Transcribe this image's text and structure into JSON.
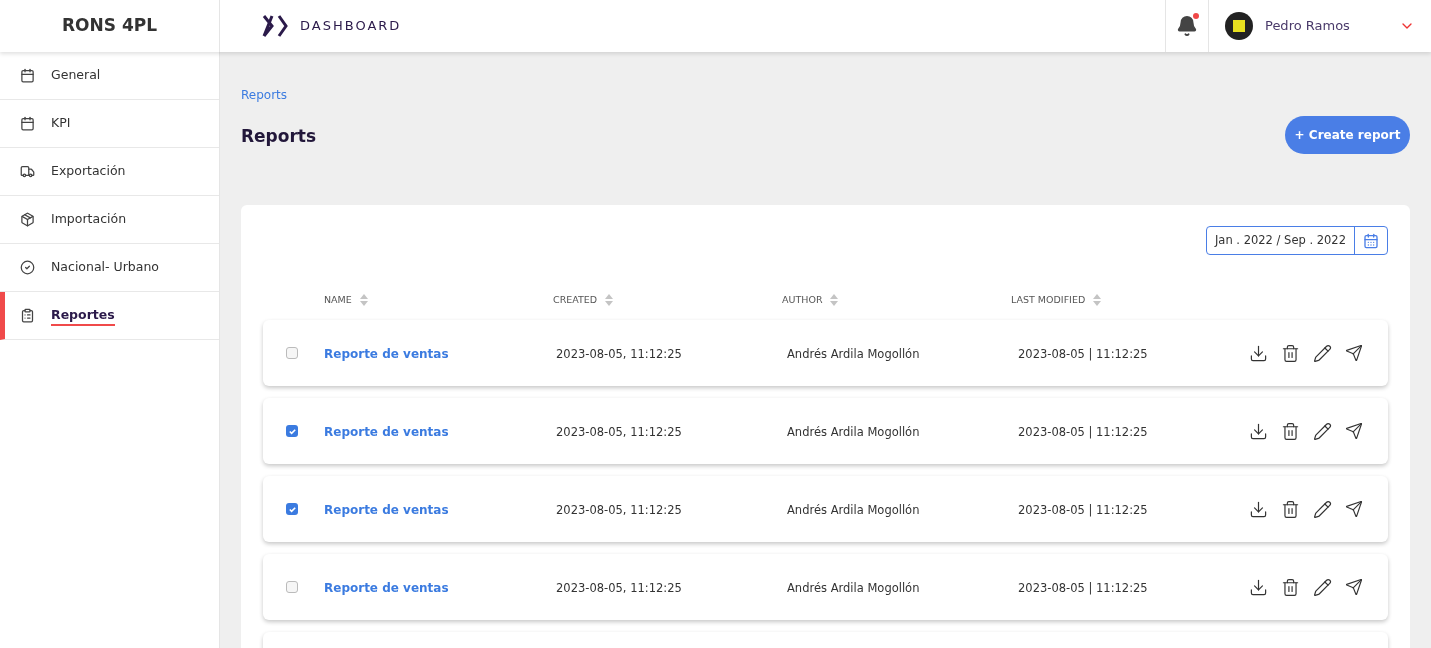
{
  "brand": "RONS 4PL",
  "header": {
    "title": "DASHBOARD",
    "notification_dot": true,
    "user_name": "Pedro Ramos"
  },
  "sidebar": {
    "items": [
      {
        "label": "General",
        "selected": false
      },
      {
        "label": "KPI",
        "selected": false
      },
      {
        "label": "Exportación",
        "selected": false
      },
      {
        "label": "Importación",
        "selected": false
      },
      {
        "label": "Nacional- Urbano",
        "selected": false
      },
      {
        "label": "Reportes",
        "selected": true
      }
    ]
  },
  "breadcrumb": "Reports",
  "page_title": "Reports",
  "create_button": "+ Create report",
  "date_range": "Jan . 2022 / Sep . 2022",
  "table": {
    "columns": [
      "NAME",
      "CREATED",
      "AUTHOR",
      "LAST MODIFIED"
    ],
    "rows": [
      {
        "name": "Reporte de ventas",
        "created": "2023-08-05, 11:12:25",
        "author": "Andrés Ardila Mogollón",
        "modified": "2023-08-05 | 11:12:25",
        "checked": false
      },
      {
        "name": "Reporte de ventas",
        "created": "2023-08-05, 11:12:25",
        "author": "Andrés Ardila Mogollón",
        "modified": "2023-08-05 | 11:12:25",
        "checked": true
      },
      {
        "name": "Reporte de ventas",
        "created": "2023-08-05, 11:12:25",
        "author": "Andrés Ardila Mogollón",
        "modified": "2023-08-05 | 11:12:25",
        "checked": true
      },
      {
        "name": "Reporte de ventas",
        "created": "2023-08-05, 11:12:25",
        "author": "Andrés Ardila Mogollón",
        "modified": "2023-08-05 | 11:12:25",
        "checked": false
      }
    ]
  }
}
